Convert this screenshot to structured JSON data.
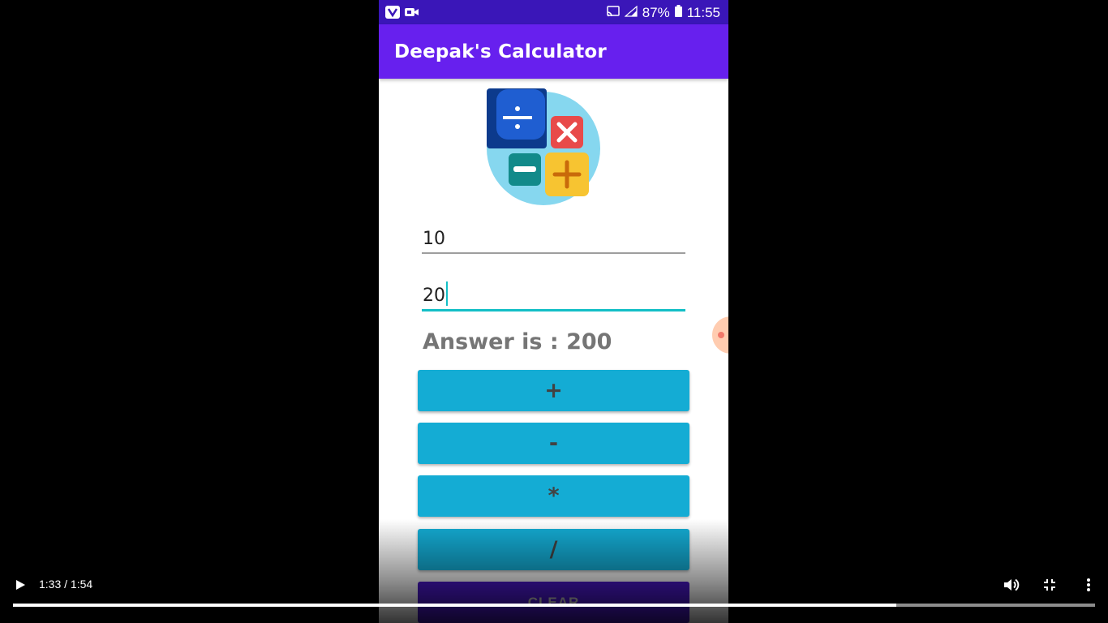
{
  "status_bar": {
    "battery": "87%",
    "time": "11:55"
  },
  "app": {
    "title": "Deepak's Calculator"
  },
  "inputs": {
    "first_value": "10",
    "second_value": "20"
  },
  "answer": "Answer is : 200",
  "buttons": {
    "add": "+",
    "subtract": "-",
    "multiply": "*",
    "divide": "/",
    "clear": "CLEAR"
  },
  "player": {
    "time_display": "1:33 / 1:54",
    "progress_fraction": 0.816
  },
  "colors": {
    "app_bar": "#6720ee",
    "status_bar": "#3a16b8",
    "operation_button": "#14acd4",
    "clear_button": "#4a18c9",
    "focus_accent": "#13bfc6"
  },
  "icons": [
    "vlc-icon",
    "video-camera-icon",
    "cast-icon",
    "signal-icon",
    "battery-icon",
    "calculator-logo",
    "play-icon",
    "volume-icon",
    "exit-fullscreen-icon",
    "more-options-icon"
  ]
}
